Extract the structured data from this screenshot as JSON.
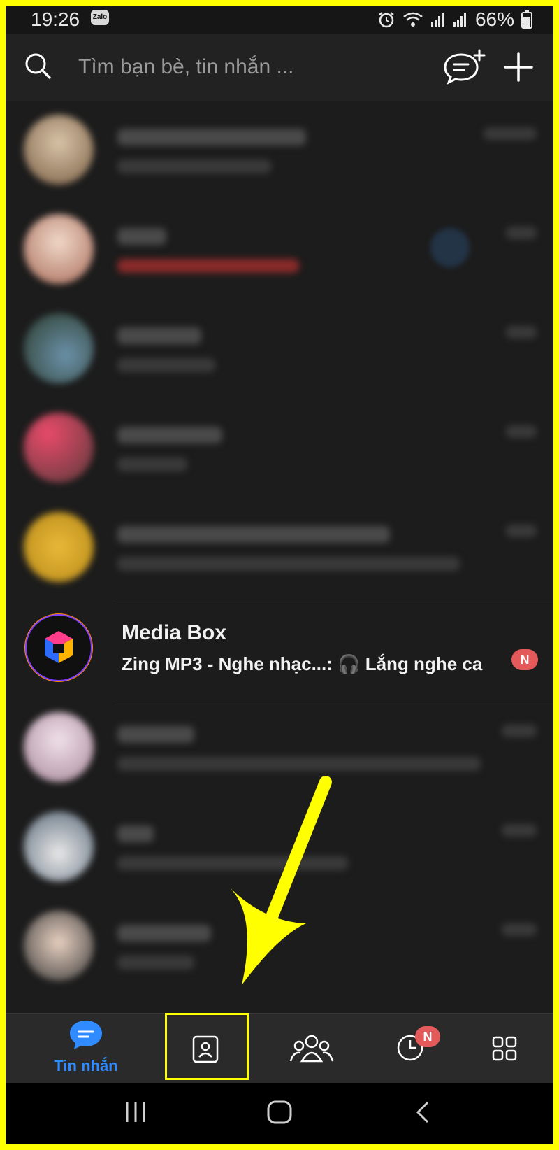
{
  "status_bar": {
    "time": "19:26",
    "app_icon_text": "Zalo",
    "battery": "66%"
  },
  "search": {
    "placeholder": "Tìm bạn bè, tin nhắn ..."
  },
  "conversations": [
    {
      "blurred": true
    },
    {
      "blurred": true
    },
    {
      "blurred": true
    },
    {
      "blurred": true
    },
    {
      "blurred": true
    },
    {
      "name": "Media Box",
      "preview": "Zing MP3 - Nghe nhạc...: 🎧 Lắng nghe ca ...",
      "badge": "N"
    },
    {
      "blurred": true
    },
    {
      "blurred": true
    },
    {
      "blurred": true
    }
  ],
  "bottom_nav": {
    "messages_label": "Tin nhắn",
    "timeline_badge": "N"
  },
  "colors": {
    "accent": "#2f8bff",
    "badge": "#e45a5a",
    "highlight": "#ffff00",
    "background": "#1c1c1c"
  },
  "icons": [
    "search-icon",
    "new-chat-icon",
    "plus-icon",
    "contacts-icon",
    "groups-icon",
    "clock-icon",
    "grid-icon",
    "arrow-annotation"
  ]
}
